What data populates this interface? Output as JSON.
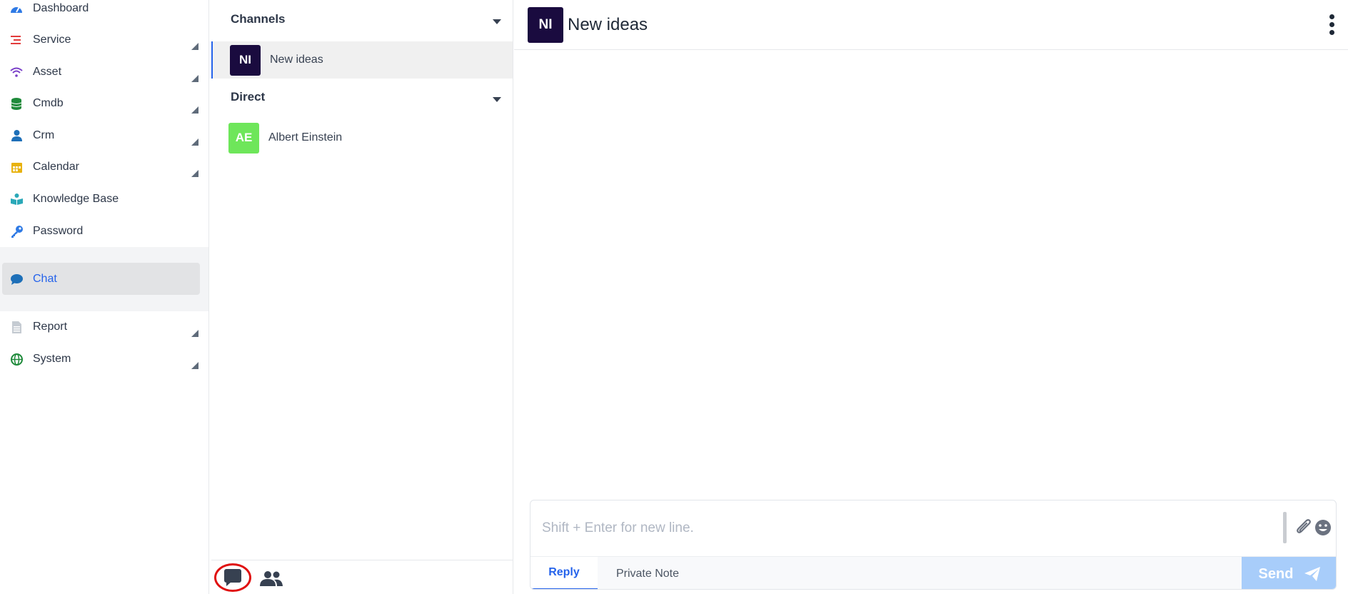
{
  "nav": {
    "items": [
      {
        "label": "Dashboard",
        "icon": "speedometer-icon",
        "color": "#2f7ae5"
      },
      {
        "label": "Service",
        "icon": "list-icon",
        "color": "#e23b3b"
      },
      {
        "label": "Asset",
        "icon": "wifi-icon",
        "color": "#7a3fc8"
      },
      {
        "label": "Cmdb",
        "icon": "database-icon",
        "color": "#1f8a3b"
      },
      {
        "label": "Crm",
        "icon": "user-icon",
        "color": "#1d6fb8"
      },
      {
        "label": "Calendar",
        "icon": "calendar-icon",
        "color": "#e8b20f"
      },
      {
        "label": "Knowledge Base",
        "icon": "book-reader-icon",
        "color": "#2aa8b8"
      },
      {
        "label": "Password",
        "icon": "key-icon",
        "color": "#2f7ae5"
      },
      {
        "label": "Chat",
        "icon": "chat-bubble-icon",
        "color": "#1d6fb8"
      },
      {
        "label": "Report",
        "icon": "document-icon",
        "color": "#9aa3ad"
      },
      {
        "label": "System",
        "icon": "globe-icon",
        "color": "#1f8a3b"
      }
    ]
  },
  "channels": {
    "heading": "Channels",
    "items": [
      {
        "initials": "NI",
        "name": "New ideas",
        "color": "#1a0b3f"
      }
    ]
  },
  "direct": {
    "heading": "Direct",
    "items": [
      {
        "initials": "AE",
        "name": "Albert Einstein",
        "color": "#6ee65a"
      }
    ]
  },
  "conversation": {
    "initials": "NI",
    "title": "New ideas",
    "avatar_color": "#1a0b3f"
  },
  "composer": {
    "placeholder": "Shift + Enter for new line.",
    "tab_reply": "Reply",
    "tab_note": "Private Note",
    "send_label": "Send"
  },
  "colors": {
    "accent": "#2563eb",
    "send_disabled": "#a8cdfa",
    "highlight_ring": "#e01010"
  }
}
